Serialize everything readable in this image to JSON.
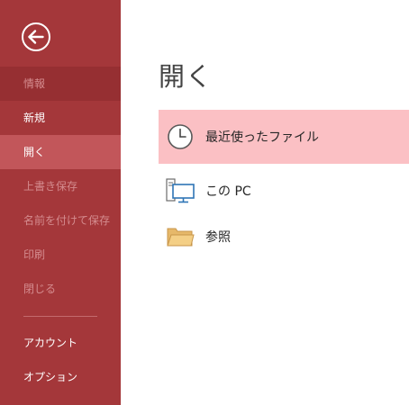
{
  "sidebar": {
    "items": [
      {
        "label": "情報"
      },
      {
        "label": "新規"
      },
      {
        "label": "開く"
      },
      {
        "label": "上書き保存"
      },
      {
        "label": "名前を付けて保存"
      },
      {
        "label": "印刷"
      },
      {
        "label": "閉じる"
      },
      {
        "label": "アカウント"
      },
      {
        "label": "オプション"
      }
    ]
  },
  "main": {
    "title": "開く",
    "options": [
      {
        "label": "最近使ったファイル",
        "icon": "clock-icon"
      },
      {
        "label": "この PC",
        "icon": "computer-icon"
      },
      {
        "label": "参照",
        "icon": "folder-icon"
      }
    ]
  },
  "colors": {
    "sidebar": "#a4373a",
    "sidebar_info": "#962f32",
    "sidebar_active": "#c2565a",
    "selected_option": "#fbc0c4"
  }
}
